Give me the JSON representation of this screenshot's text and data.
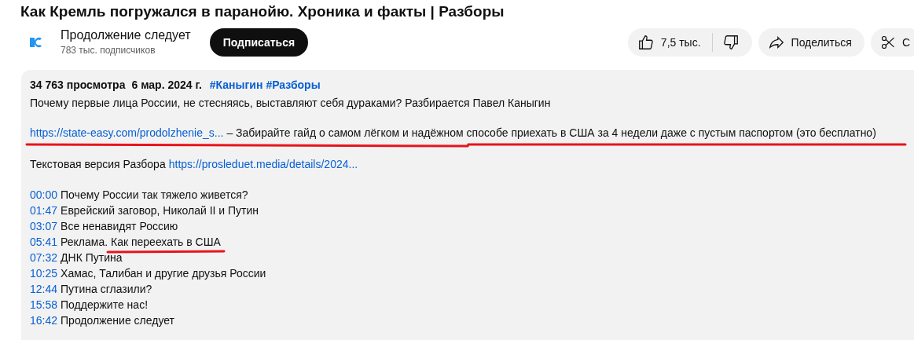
{
  "video": {
    "title": "Как Кремль погружался в паранойю. Хроника и факты | Разборы"
  },
  "channel": {
    "name": "Продолжение следует",
    "subscribers": "783 тыс. подписчиков",
    "subscribe_button": "Подписаться"
  },
  "actions": {
    "likes": "7,5 тыс.",
    "share": "Поделиться",
    "clip": "С"
  },
  "description": {
    "views": "34 763 просмотра",
    "date": "6 мар. 2024 г.",
    "hashtags": [
      "#Каныгин",
      "#Разборы"
    ],
    "summary": "Почему первые лица России, не стесняясь, выставляют себя дураками? Разбирается Павел Каныгин",
    "promo_link": "https://state-easy.com/prodolzhenie_s...",
    "promo_text": "– Забирайте гайд о самом лёгком и надёжном способе приехать в США за 4 недели даже с пустым паспортом (это бесплатно)",
    "text_version_label": "Текстовая версия Разбора",
    "text_version_link": "https://prosleduet.media/details/2024...",
    "chapters": [
      {
        "time": "00:00",
        "title": "Почему России так тяжело живется?"
      },
      {
        "time": "01:47",
        "title": "Еврейский заговор, Николай II и Путин"
      },
      {
        "time": "03:07",
        "title": "Все ненавидят Россию"
      },
      {
        "time": "05:41",
        "title": "Реклама. Как переехать в США"
      },
      {
        "time": "07:32",
        "title": "ДНК Путина"
      },
      {
        "time": "10:25",
        "title": "Хамас, Талибан и другие друзья России"
      },
      {
        "time": "12:44",
        "title": "Путина сглазили?"
      },
      {
        "time": "15:58",
        "title": "Поддержите нас!"
      },
      {
        "time": "16:42",
        "title": "Продолжение следует"
      }
    ]
  }
}
